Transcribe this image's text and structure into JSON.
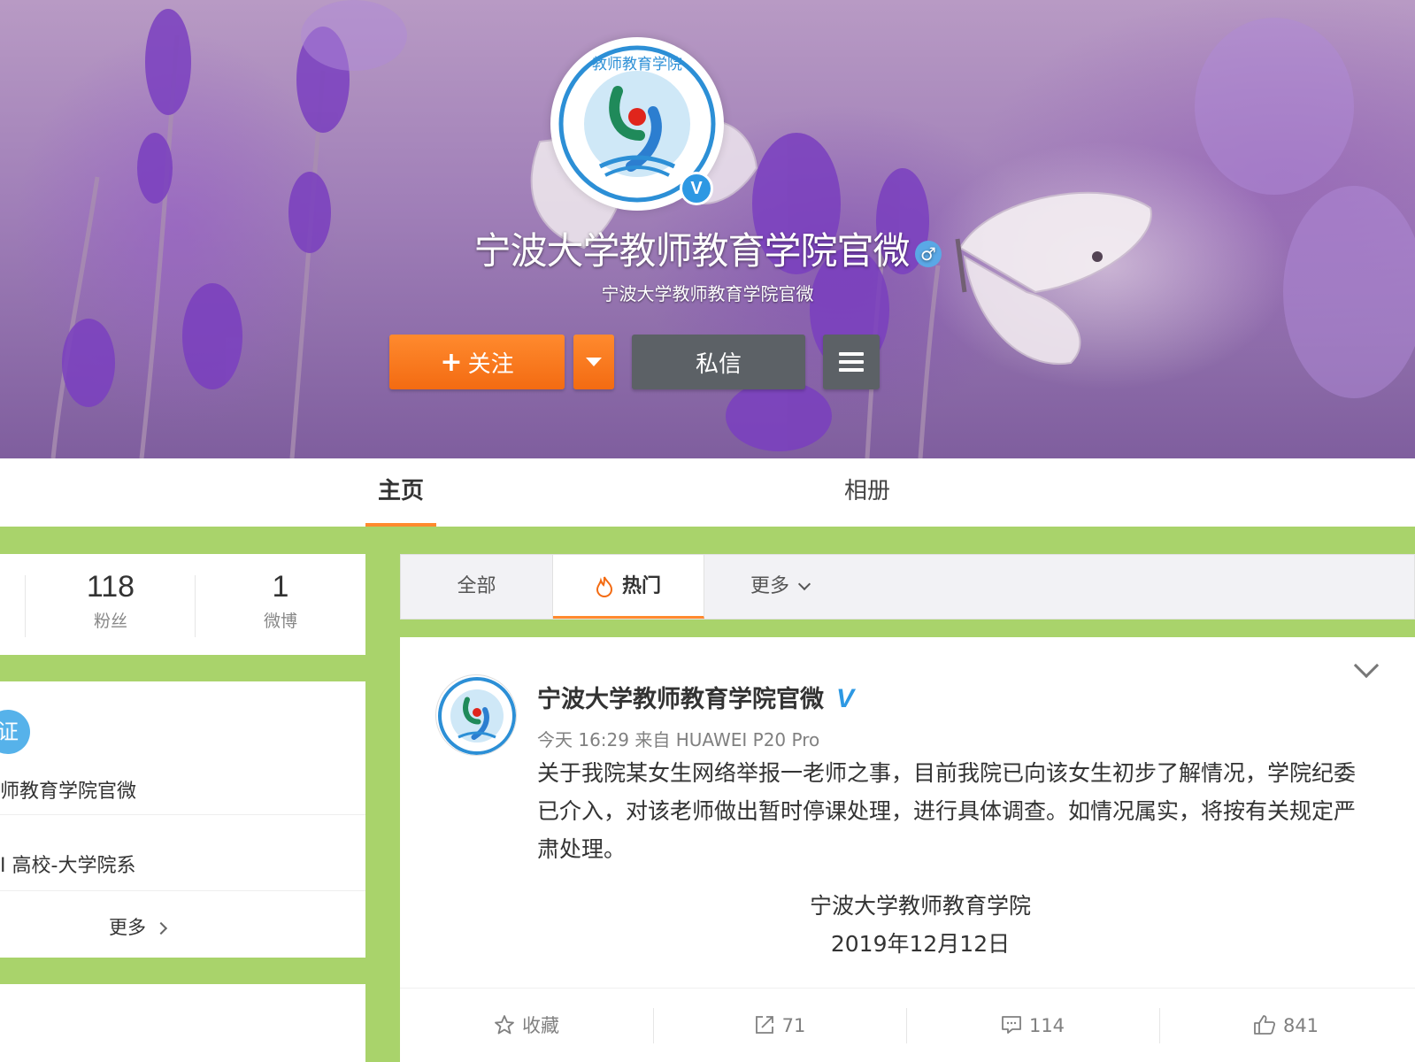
{
  "profile": {
    "name": "宁波大学教师教育学院官微",
    "description": "宁波大学教师教育学院官微",
    "logo_text": "教师教育学院",
    "verified_mark": "V",
    "gender_symbol": "♂"
  },
  "buttons": {
    "follow_plus": "+",
    "follow": "关注",
    "message": "私信"
  },
  "tabs": {
    "home": "主页",
    "album": "相册"
  },
  "stats": {
    "fans_count": "118",
    "fans_label": "粉丝",
    "weibo_count": "1",
    "weibo_label": "微博"
  },
  "info": {
    "badge_char": "证",
    "name_fragment": "师教育学院官微",
    "category": "高校-大学院系",
    "category_prefix": "I",
    "more": "更多"
  },
  "filters": {
    "all": "全部",
    "hot": "热门",
    "more": "更多"
  },
  "post": {
    "author": "宁波大学教师教育学院官微",
    "verified_mark": "V",
    "meta": "今天 16:29 来自 HUAWEI P20 Pro",
    "text": "关于我院某女生网络举报一老师之事，目前我院已向该女生初步了解情况，学院纪委已介入，对该老师做出暂时停课处理，进行具体调查。如情况属实，将按有关规定严肃处理。",
    "sign_org": "宁波大学教师教育学院",
    "sign_date": "2019年12月12日"
  },
  "actions": {
    "favorite": "收藏",
    "repost": "71",
    "comment": "114",
    "like": "841"
  },
  "colors": {
    "accent_orange": "#f36b12",
    "page_green": "#a9d36b",
    "verified_blue": "#2d98e3",
    "button_gray": "#5c6166"
  }
}
